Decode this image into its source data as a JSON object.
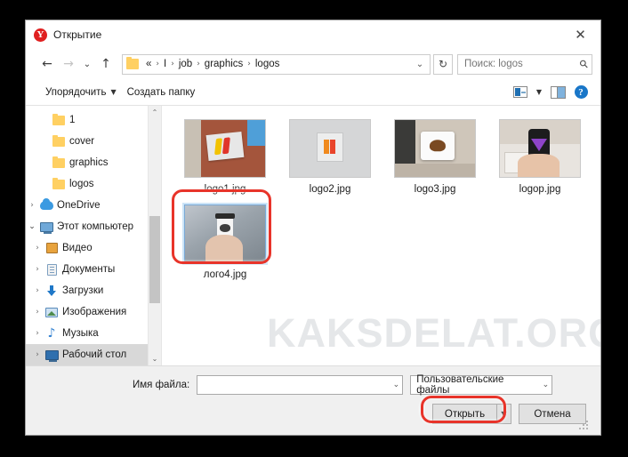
{
  "window": {
    "title": "Открытие",
    "app_icon": "yandex-logo-icon",
    "close_label": "✕"
  },
  "nav": {
    "back_icon": "←",
    "forward_icon": "→",
    "recent_icon": "⌄",
    "up_icon": "↑",
    "breadcrumb": {
      "overflow": "«",
      "parts": [
        "I",
        "job",
        "graphics",
        "logos"
      ],
      "separator": "›",
      "dropdown_icon": "⌄"
    },
    "refresh_icon": "↻",
    "search": {
      "placeholder": "Поиск: logos",
      "icon": "⚲"
    }
  },
  "toolbar": {
    "organize_label": "Упорядочить",
    "organize_caret": "▼",
    "new_folder_label": "Создать папку",
    "view_caret": "▼",
    "view_icon": "view-layout-icon",
    "preview_pane_icon": "preview-pane-icon",
    "help_icon": "?"
  },
  "sidebar": {
    "items": [
      {
        "label": "1",
        "icon": "folder-icon",
        "twisty": "",
        "indent": 28,
        "selected": false
      },
      {
        "label": "cover",
        "icon": "folder-icon",
        "twisty": "",
        "indent": 28,
        "selected": false
      },
      {
        "label": "graphics",
        "icon": "folder-icon",
        "twisty": "",
        "indent": 28,
        "selected": false
      },
      {
        "label": "logos",
        "icon": "folder-icon",
        "twisty": "",
        "indent": 28,
        "selected": false
      },
      {
        "label": "OneDrive",
        "icon": "cloud-icon",
        "twisty": "›",
        "indent": 8,
        "selected": false
      },
      {
        "label": "Этот компьютер",
        "icon": "computer-icon",
        "twisty": "⌄",
        "indent": 8,
        "selected": false
      },
      {
        "label": "Видео",
        "icon": "video-icon",
        "twisty": "›",
        "indent": 20,
        "selected": false
      },
      {
        "label": "Документы",
        "icon": "documents-icon",
        "twisty": "›",
        "indent": 20,
        "selected": false
      },
      {
        "label": "Загрузки",
        "icon": "downloads-icon",
        "twisty": "›",
        "indent": 20,
        "selected": false
      },
      {
        "label": "Изображения",
        "icon": "pictures-icon",
        "twisty": "›",
        "indent": 20,
        "selected": false
      },
      {
        "label": "Музыка",
        "icon": "music-icon",
        "twisty": "›",
        "indent": 20,
        "selected": false
      },
      {
        "label": "Рабочий стол",
        "icon": "desktop-icon",
        "twisty": "›",
        "indent": 20,
        "selected": true
      }
    ],
    "scroll_up_icon": "⌃",
    "scroll_down_icon": "⌄"
  },
  "files": [
    {
      "name": "logo1.jpg",
      "thumb": "brick-wall-sign",
      "selected": false
    },
    {
      "name": "logo2.jpg",
      "thumb": "gray-plate-logo",
      "selected": false
    },
    {
      "name": "logo3.jpg",
      "thumb": "wall-badge-sign",
      "selected": false
    },
    {
      "name": "logop.jpg",
      "thumb": "hand-phone-office",
      "selected": false
    },
    {
      "name": "лого4.jpg",
      "thumb": "hand-coffee-cup",
      "selected": true
    }
  ],
  "watermark": "KAKSDELAT.ORG",
  "footer": {
    "filename_label": "Имя файла:",
    "filename_value": "",
    "filename_caret": "⌄",
    "filter_value": "Пользовательские файлы",
    "filter_caret": "⌄",
    "open_label": "Открыть",
    "open_caret": "▼",
    "cancel_label": "Отмена"
  },
  "colors": {
    "annotation": "#e8342a",
    "accent": "#1976c8",
    "folder": "#ffd062",
    "selection": "#d8d8d8"
  }
}
